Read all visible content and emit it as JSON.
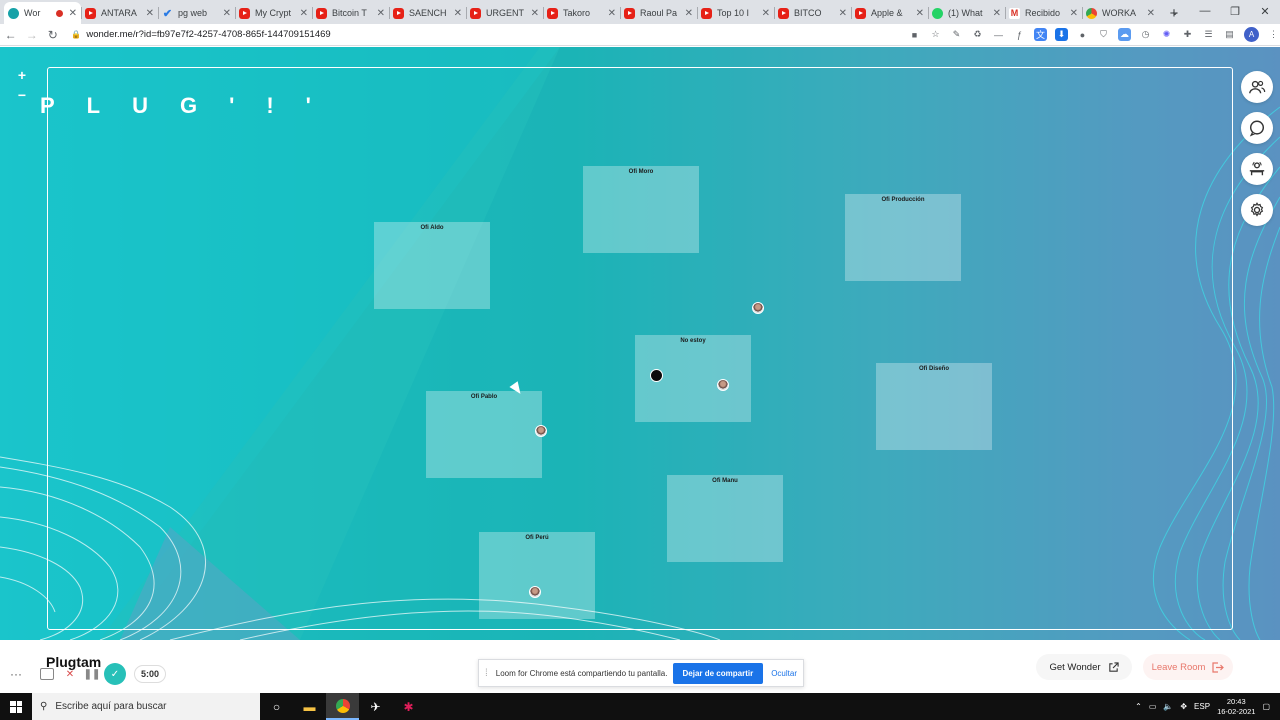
{
  "browser": {
    "tabs": [
      {
        "icon": "wonder",
        "label": "Wor",
        "active": true,
        "recording": true
      },
      {
        "icon": "youtube",
        "label": "ANTARA"
      },
      {
        "icon": "check",
        "label": "pg web"
      },
      {
        "icon": "youtube",
        "label": "My Crypt"
      },
      {
        "icon": "youtube",
        "label": "Bitcoin T"
      },
      {
        "icon": "youtube",
        "label": "SAENCH"
      },
      {
        "icon": "youtube",
        "label": "URGENT"
      },
      {
        "icon": "youtube",
        "label": "Takoro"
      },
      {
        "icon": "youtube",
        "label": "Raoul Pa"
      },
      {
        "icon": "youtube",
        "label": "Top 10 I"
      },
      {
        "icon": "youtube",
        "label": "BITCO"
      },
      {
        "icon": "youtube",
        "label": "Apple &"
      },
      {
        "icon": "whatsapp",
        "label": "(1) What"
      },
      {
        "icon": "gmail",
        "label": "Recibido"
      },
      {
        "icon": "chrome",
        "label": "WORKA"
      }
    ],
    "url": "wonder.me/r?id=fb97e7f2-4257-4708-865f-144709151469",
    "profile_initial": "A"
  },
  "room": {
    "logo": "PLUG'!'",
    "zoom_in": "+",
    "zoom_out": "−",
    "zones": [
      {
        "label": "Ofi Aldo"
      },
      {
        "label": "Ofi Moro"
      },
      {
        "label": "Ofi Producción"
      },
      {
        "label": "No estoy"
      },
      {
        "label": "Ofi Pablo"
      },
      {
        "label": "Ofi Diseño"
      },
      {
        "label": "Ofi Manu"
      },
      {
        "label": "Ofi Perú"
      }
    ]
  },
  "sidebar_icons": [
    "people-icon",
    "chat-icon",
    "broadcast-icon",
    "settings-icon"
  ],
  "appbar": {
    "room_name": "Plugtam",
    "more": "···",
    "timer": "5:00",
    "get_wonder": "Get Wonder",
    "leave_room": "Leave Room"
  },
  "loom_banner": {
    "message": "Loom for Chrome está compartiendo tu pantalla.",
    "stop_label": "Dejar de compartir",
    "hide_label": "Ocultar"
  },
  "taskbar": {
    "search_placeholder": "Escribe aquí para buscar",
    "language": "ESP",
    "time": "20:43",
    "date": "16-02-2021"
  },
  "colors": {
    "room_left": "#1bc7cf",
    "room_right": "#7b7fc6",
    "accent_teal": "#27c0b8",
    "loom_blue": "#1a73e8",
    "leave_red": "#e8786c"
  }
}
